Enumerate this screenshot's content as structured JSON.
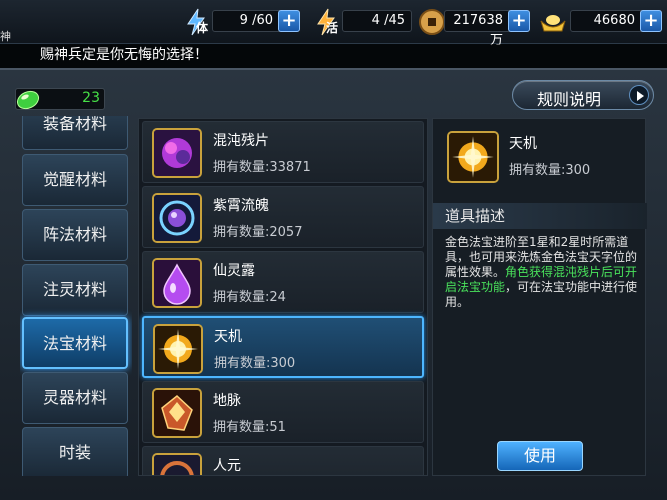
{
  "topbar": {
    "corner_text": "神",
    "stamina": {
      "label": "体",
      "value": "9 /60"
    },
    "vitality": {
      "label": "活",
      "value": "4 /45"
    },
    "coins": {
      "value": "217638万"
    },
    "ingots": {
      "value": "46680"
    },
    "plus": "+"
  },
  "marquee": {
    "text": "赐神兵定是你无悔的选择！"
  },
  "gem_counter": {
    "value": "23"
  },
  "rules_button": {
    "label": "规则说明"
  },
  "categories": [
    {
      "label": "装备材料"
    },
    {
      "label": "觉醒材料"
    },
    {
      "label": "阵法材料"
    },
    {
      "label": "注灵材料"
    },
    {
      "label": "法宝材料"
    },
    {
      "label": "灵器材料"
    },
    {
      "label": "时装"
    }
  ],
  "active_category": "法宝材料",
  "items": [
    {
      "name": "混沌残片",
      "qty": "拥有数量:33871",
      "icon": "chaos-shard-icon"
    },
    {
      "name": "紫霄流魄",
      "qty": "拥有数量:2057",
      "icon": "purple-orb-icon"
    },
    {
      "name": "仙灵露",
      "qty": "拥有数量:24",
      "icon": "purple-drop-icon"
    },
    {
      "name": "天机",
      "qty": "拥有数量:300",
      "icon": "golden-star-icon"
    },
    {
      "name": "地脉",
      "qty": "拥有数量:51",
      "icon": "earth-crystal-icon"
    },
    {
      "name": "人元",
      "qty": "",
      "icon": "human-origin-icon"
    }
  ],
  "selected_item": {
    "name": "天机",
    "qty": "拥有数量:300",
    "section_title": "道具描述",
    "desc_part1": "金色法宝进阶至1星和2星时所需道具，也可用来洗炼金色法宝天字位的属性效果。",
    "desc_highlight": "角色获得混沌残片后可开启法宝功能",
    "desc_part2": "，可在法宝功能中进行使用。"
  },
  "use_button": {
    "label": "使用"
  },
  "colors": {
    "highlight_green": "#49e25b",
    "accent_blue": "#4db6ff",
    "gold_frame": "#c9a23c"
  }
}
